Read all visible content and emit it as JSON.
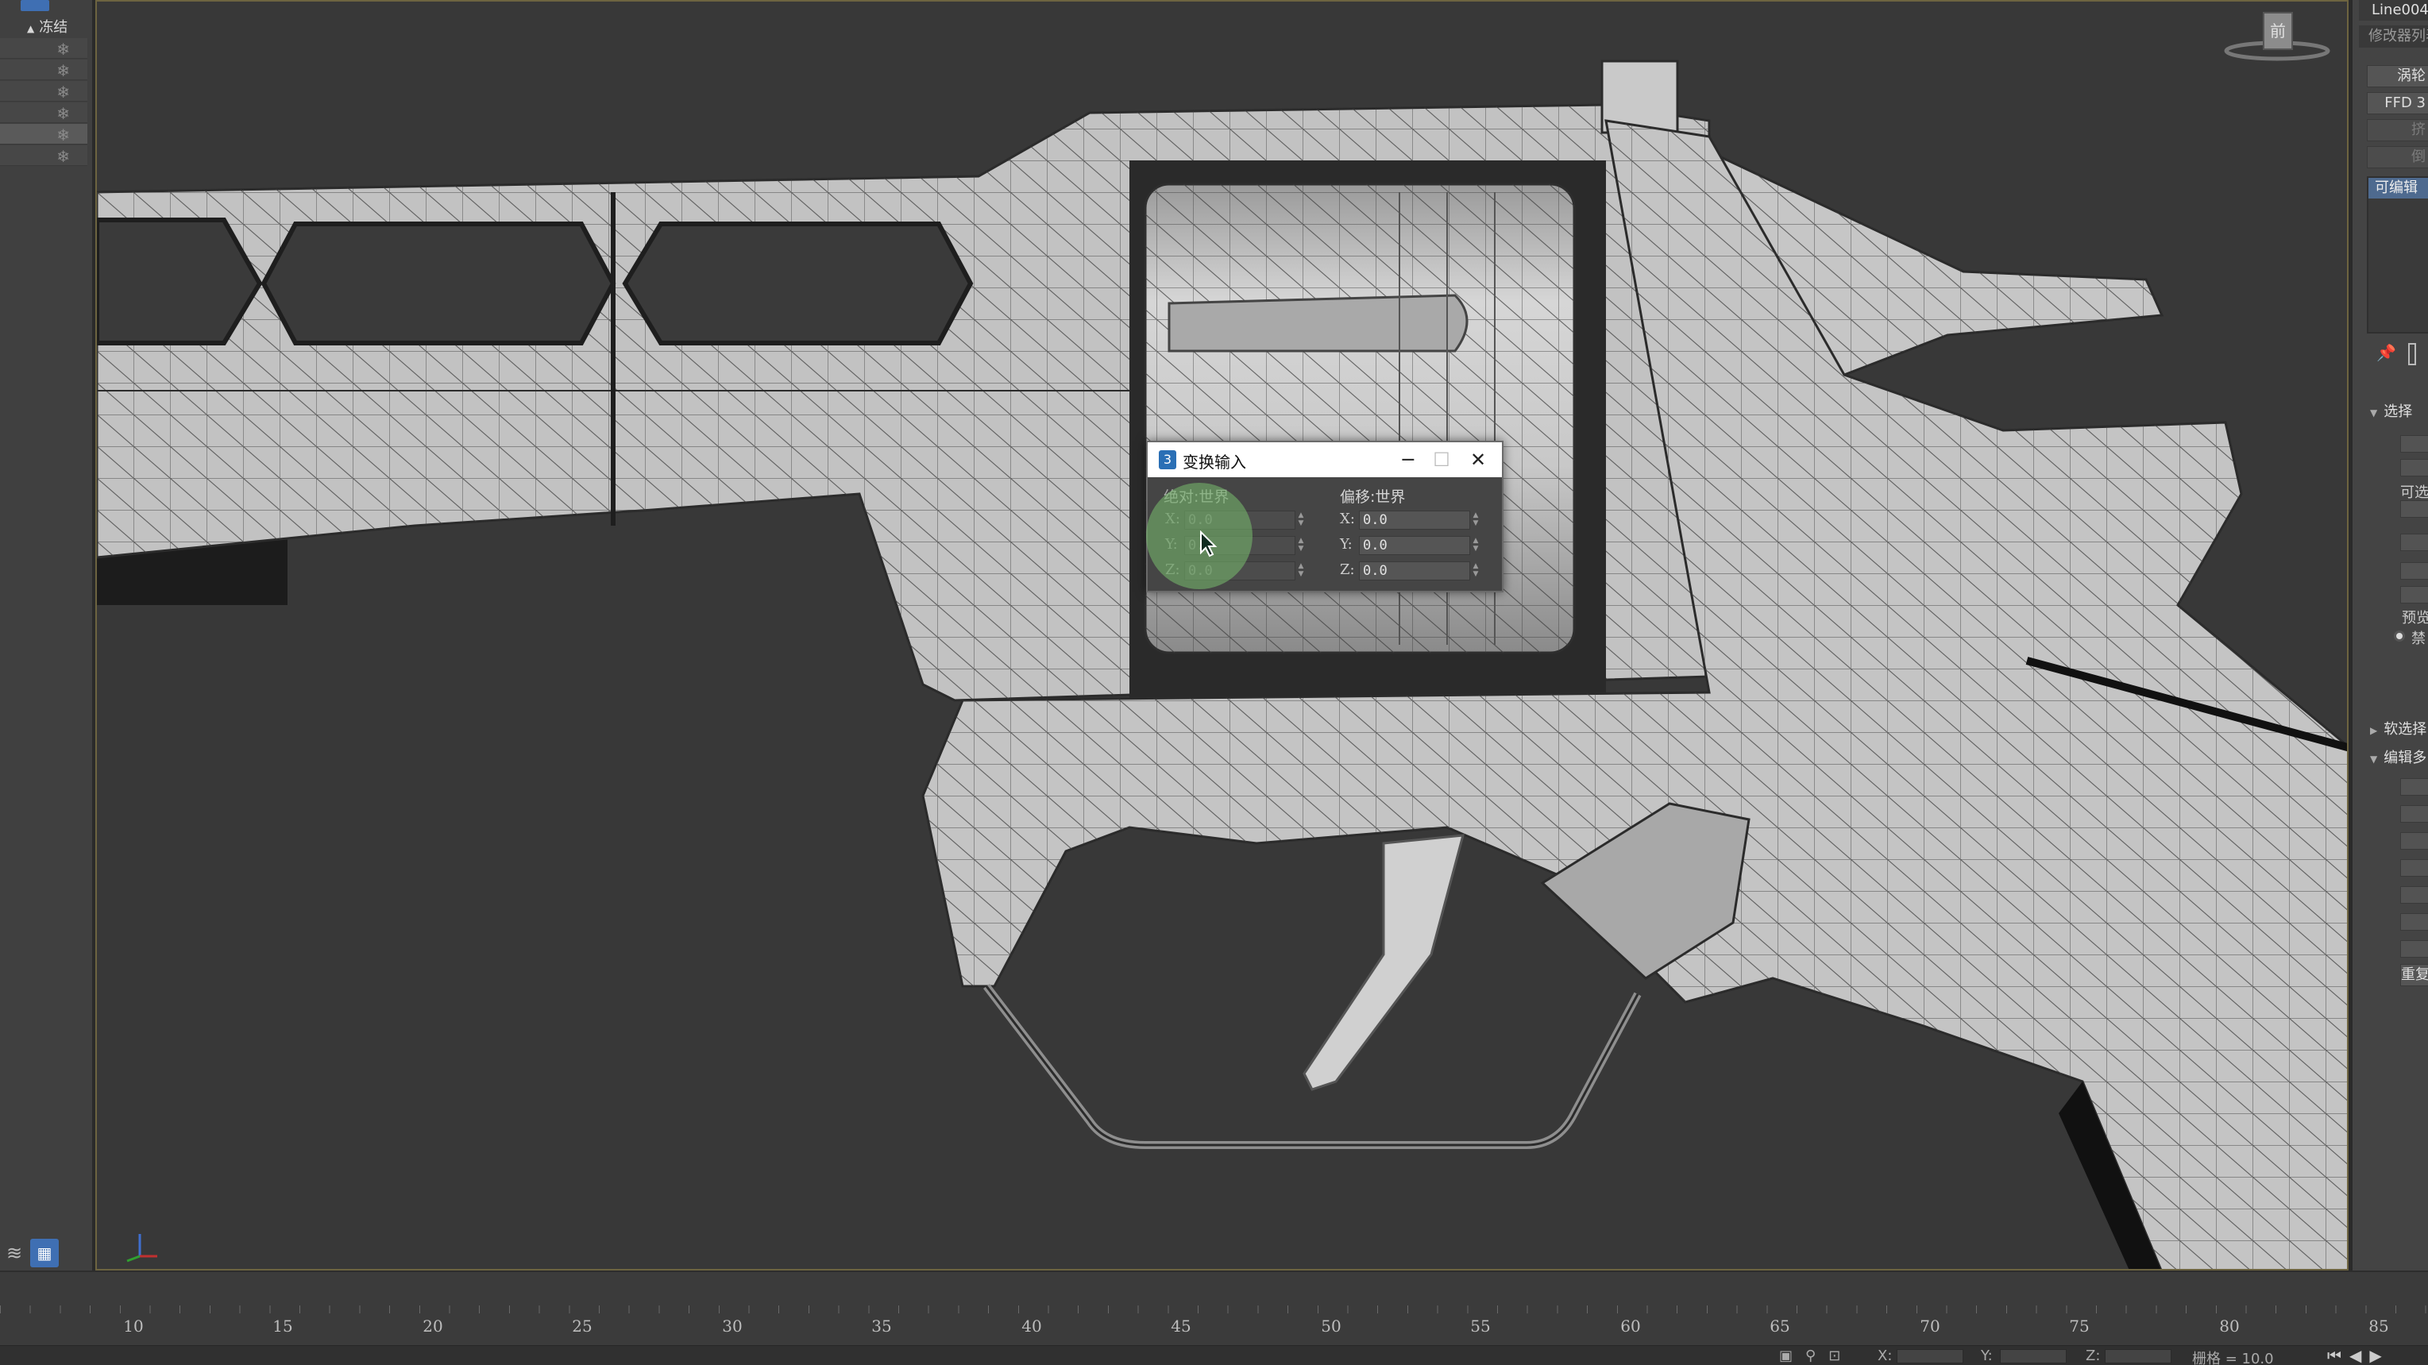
{
  "scene_explorer": {
    "freeze_label": "冻结",
    "rows": 6
  },
  "command_panel": {
    "object_name": "Line004",
    "modifier_list": "修改器列表",
    "buttons": [
      "涡轮",
      "FFD 3",
      "挤",
      "倒"
    ],
    "stack_item": "可编辑",
    "rollouts": {
      "selection": "选择",
      "selectable": "可选",
      "preview": "预览",
      "disable": "禁",
      "soft_selection": "软选择",
      "edit_poly": "编辑多",
      "repeat": "重复"
    }
  },
  "viewport": {
    "viewcube_label": "前"
  },
  "dialog": {
    "title": "变换输入",
    "absolute_label": "绝对:世界",
    "offset_label": "偏移:世界",
    "absolute": {
      "x": "0.0",
      "y": "0.0",
      "z": "0.0"
    },
    "offset": {
      "x": "0.0",
      "y": "0.0",
      "z": "0.0"
    },
    "axis_x": "X:",
    "axis_y": "Y:",
    "axis_z": "Z:",
    "minimize": "─",
    "maximize": "☐",
    "close": "✕"
  },
  "timeline": {
    "ticks": [
      "10",
      "15",
      "20",
      "25",
      "30",
      "35",
      "40",
      "45",
      "50",
      "55",
      "60",
      "65",
      "70",
      "75",
      "80",
      "85"
    ]
  },
  "statusbar": {
    "x_label": "X:",
    "y_label": "Y:",
    "z_label": "Z:",
    "grid_label": "栅格 = 10.0"
  },
  "colors": {
    "viewport_bg": "#383838",
    "viewport_border": "#6d6440",
    "mesh_fill": "#bfbfbf",
    "wire": "#2e2e2e",
    "accent": "#3f6fb3"
  }
}
